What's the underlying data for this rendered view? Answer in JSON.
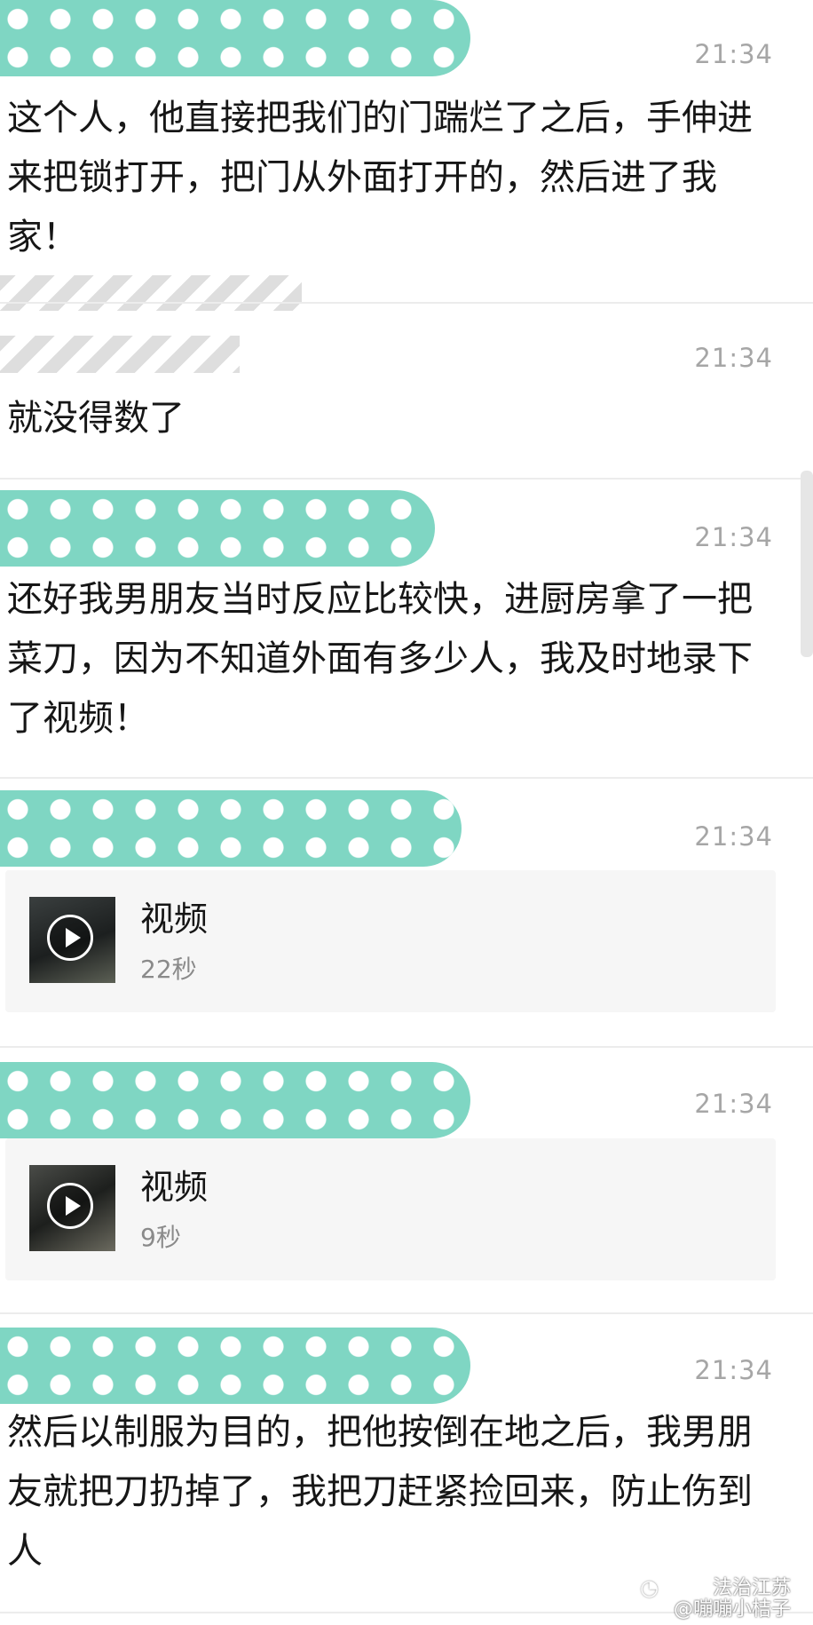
{
  "colors": {
    "mask_accent": "#7fd6c3",
    "time_gray": "#a6a6a6",
    "divider": "#ececec"
  },
  "messages": [
    {
      "time": "21:34",
      "text": "这个人，他直接把我们的门踹烂了之后，手伸进来把锁打开，把门从外面打开的，然后进了我家！"
    },
    {
      "time": "21:34",
      "text": "就没得数了"
    },
    {
      "time": "21:34",
      "text": "还好我男朋友当时反应比较快，进厨房拿了一把菜刀，因为不知道外面有多少人，我及时地录下了视频！"
    },
    {
      "time": "21:34",
      "video": {
        "title": "视频",
        "duration": "22秒",
        "icon": "play-icon"
      }
    },
    {
      "time": "21:34",
      "video": {
        "title": "视频",
        "duration": "9秒",
        "icon": "play-icon"
      }
    },
    {
      "time": "21:34",
      "text": "然后以制服为目的，把他按倒在地之后，我男朋友就把刀扔掉了，我把刀赶紧捡回来，防止伤到人"
    }
  ],
  "watermark": {
    "line1": "法治江苏",
    "line2": "@嘣嘣小桔子",
    "icon": "weibo-icon"
  }
}
